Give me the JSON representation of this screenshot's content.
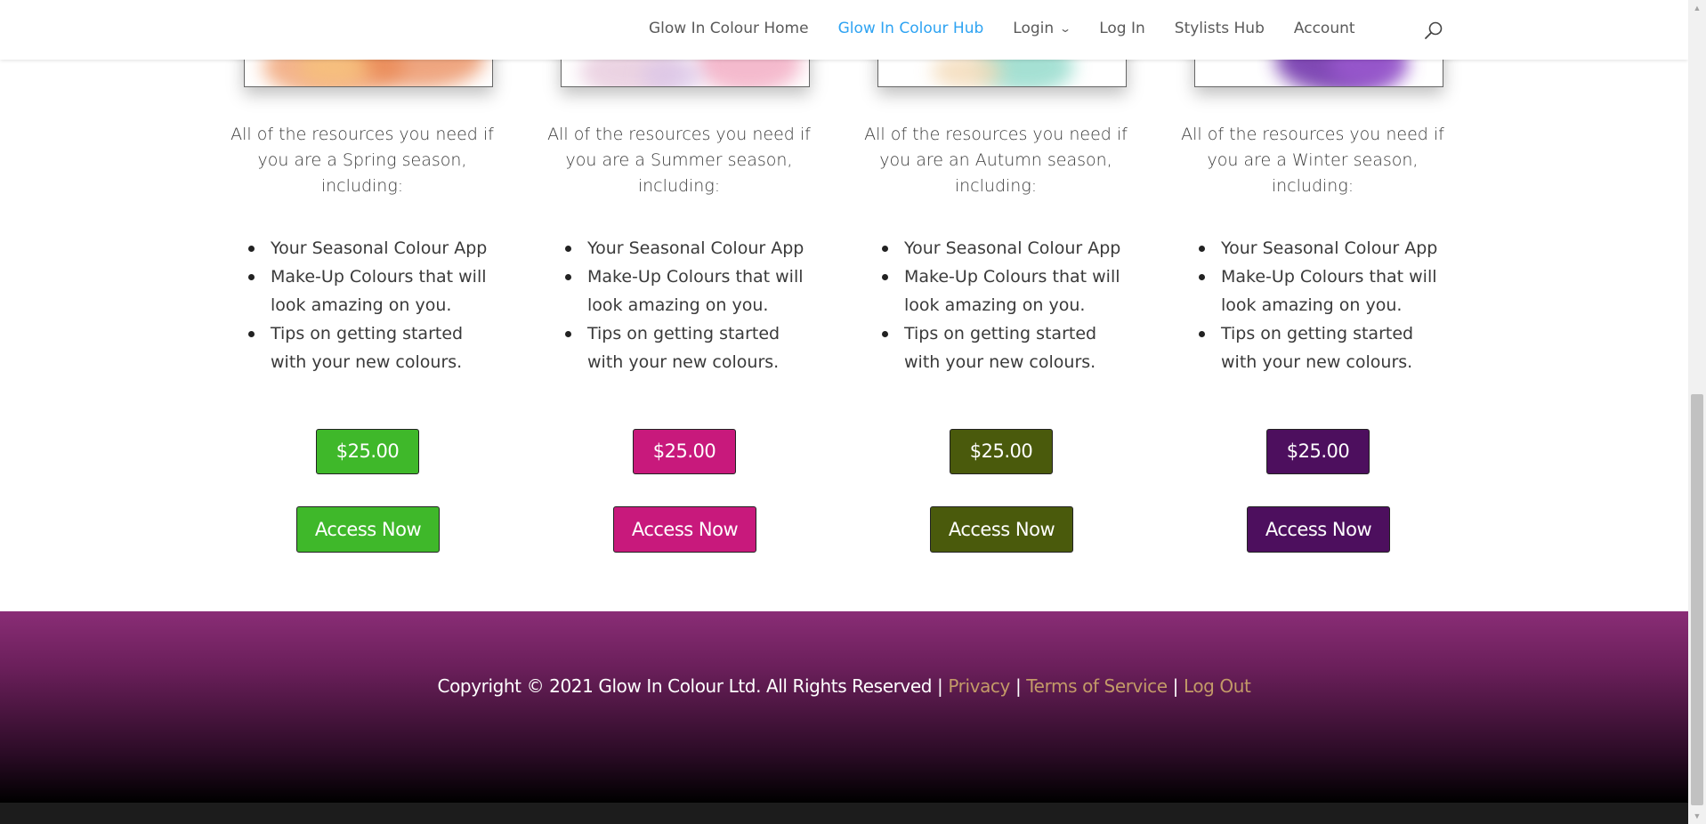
{
  "nav": {
    "items": [
      {
        "label": "Glow In Colour Home",
        "active": false,
        "dropdown": false
      },
      {
        "label": "Glow In Colour Hub",
        "active": true,
        "dropdown": false
      },
      {
        "label": "Login",
        "active": false,
        "dropdown": true
      },
      {
        "label": "Log In",
        "active": false,
        "dropdown": false
      },
      {
        "label": "Stylists Hub",
        "active": false,
        "dropdown": false
      },
      {
        "label": "Account",
        "active": false,
        "dropdown": false
      }
    ],
    "search_icon": "search-icon",
    "active_color": "#2ea3f2"
  },
  "seasons": [
    {
      "id": "spring",
      "desc": "All of the resources you need if you are a Spring season, including:",
      "features": [
        "Your Seasonal Colour App",
        "Make-Up Colours that will look amazing on you.",
        "Tips on getting started with your new colours."
      ],
      "price": "$25.00",
      "cta": "Access Now",
      "color": "#3fb82a"
    },
    {
      "id": "summer",
      "desc": "All of the resources you need if you are a Summer season, including:",
      "features": [
        "Your Seasonal Colour App",
        "Make-Up Colours that will look amazing on you.",
        "Tips on getting started with your new colours."
      ],
      "price": "$25.00",
      "cta": "Access Now",
      "color": "#c8197c"
    },
    {
      "id": "autumn",
      "desc": "All of the resources you need if you are an Autumn season, including:",
      "features": [
        "Your Seasonal Colour App",
        "Make-Up Colours that will look amazing on you.",
        "Tips on getting started with your new colours."
      ],
      "price": "$25.00",
      "cta": "Access Now",
      "color": "#4a5a0c"
    },
    {
      "id": "winter",
      "desc": "All of the resources you need if you are a Winter season, including:",
      "features": [
        "Your Seasonal Colour App",
        "Make-Up Colours that will look amazing on you.",
        "Tips on getting started with your new colours."
      ],
      "price": "$25.00",
      "cta": "Access Now",
      "color": "#4d0f5e"
    }
  ],
  "footer": {
    "copyright": "Copyright © 2021 Glow In Colour Ltd. All Rights Reserved",
    "sep": "|",
    "links": [
      "Privacy",
      "Terms of Service",
      "Log Out"
    ],
    "link_color": "#c39a68"
  }
}
